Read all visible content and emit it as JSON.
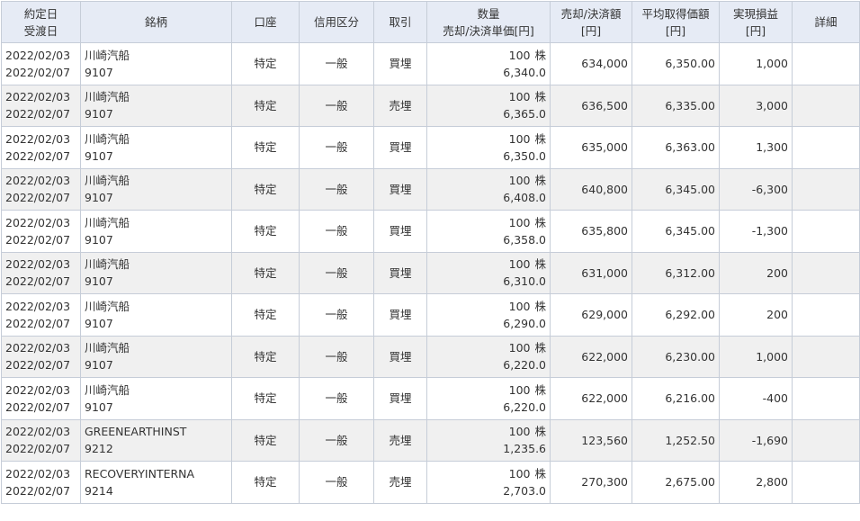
{
  "headers": {
    "date_top": "約定日",
    "date_bottom": "受渡日",
    "name": "銘柄",
    "account": "口座",
    "margin": "信用区分",
    "trade": "取引",
    "qty_top": "数量",
    "qty_bottom": "売却/決済単価[円]",
    "amount_top": "売却/決済額",
    "amount_bottom": "[円]",
    "avg_top": "平均取得価額",
    "avg_bottom": "[円]",
    "pl_top": "実現損益",
    "pl_bottom": "[円]",
    "detail": "詳細"
  },
  "rows": [
    {
      "trade_date": "2022/02/03",
      "settle_date": "2022/02/07",
      "name": "川崎汽船",
      "code": "9107",
      "account": "特定",
      "margin": "一般",
      "trade": "買埋",
      "qty": "100",
      "unit": "株",
      "price": "6,340.0",
      "amount": "634,000",
      "avg": "6,350.00",
      "pl": "1,000"
    },
    {
      "trade_date": "2022/02/03",
      "settle_date": "2022/02/07",
      "name": "川崎汽船",
      "code": "9107",
      "account": "特定",
      "margin": "一般",
      "trade": "売埋",
      "qty": "100",
      "unit": "株",
      "price": "6,365.0",
      "amount": "636,500",
      "avg": "6,335.00",
      "pl": "3,000"
    },
    {
      "trade_date": "2022/02/03",
      "settle_date": "2022/02/07",
      "name": "川崎汽船",
      "code": "9107",
      "account": "特定",
      "margin": "一般",
      "trade": "買埋",
      "qty": "100",
      "unit": "株",
      "price": "6,350.0",
      "amount": "635,000",
      "avg": "6,363.00",
      "pl": "1,300"
    },
    {
      "trade_date": "2022/02/03",
      "settle_date": "2022/02/07",
      "name": "川崎汽船",
      "code": "9107",
      "account": "特定",
      "margin": "一般",
      "trade": "買埋",
      "qty": "100",
      "unit": "株",
      "price": "6,408.0",
      "amount": "640,800",
      "avg": "6,345.00",
      "pl": "-6,300"
    },
    {
      "trade_date": "2022/02/03",
      "settle_date": "2022/02/07",
      "name": "川崎汽船",
      "code": "9107",
      "account": "特定",
      "margin": "一般",
      "trade": "買埋",
      "qty": "100",
      "unit": "株",
      "price": "6,358.0",
      "amount": "635,800",
      "avg": "6,345.00",
      "pl": "-1,300"
    },
    {
      "trade_date": "2022/02/03",
      "settle_date": "2022/02/07",
      "name": "川崎汽船",
      "code": "9107",
      "account": "特定",
      "margin": "一般",
      "trade": "買埋",
      "qty": "100",
      "unit": "株",
      "price": "6,310.0",
      "amount": "631,000",
      "avg": "6,312.00",
      "pl": "200"
    },
    {
      "trade_date": "2022/02/03",
      "settle_date": "2022/02/07",
      "name": "川崎汽船",
      "code": "9107",
      "account": "特定",
      "margin": "一般",
      "trade": "買埋",
      "qty": "100",
      "unit": "株",
      "price": "6,290.0",
      "amount": "629,000",
      "avg": "6,292.00",
      "pl": "200"
    },
    {
      "trade_date": "2022/02/03",
      "settle_date": "2022/02/07",
      "name": "川崎汽船",
      "code": "9107",
      "account": "特定",
      "margin": "一般",
      "trade": "買埋",
      "qty": "100",
      "unit": "株",
      "price": "6,220.0",
      "amount": "622,000",
      "avg": "6,230.00",
      "pl": "1,000"
    },
    {
      "trade_date": "2022/02/03",
      "settle_date": "2022/02/07",
      "name": "川崎汽船",
      "code": "9107",
      "account": "特定",
      "margin": "一般",
      "trade": "買埋",
      "qty": "100",
      "unit": "株",
      "price": "6,220.0",
      "amount": "622,000",
      "avg": "6,216.00",
      "pl": "-400"
    },
    {
      "trade_date": "2022/02/03",
      "settle_date": "2022/02/07",
      "name": "GREENEARTHINST",
      "code": "9212",
      "account": "特定",
      "margin": "一般",
      "trade": "売埋",
      "qty": "100",
      "unit": "株",
      "price": "1,235.6",
      "amount": "123,560",
      "avg": "1,252.50",
      "pl": "-1,690"
    },
    {
      "trade_date": "2022/02/03",
      "settle_date": "2022/02/07",
      "name": "RECOVERYINTERNA",
      "code": "9214",
      "account": "特定",
      "margin": "一般",
      "trade": "売埋",
      "qty": "100",
      "unit": "株",
      "price": "2,703.0",
      "amount": "270,300",
      "avg": "2,675.00",
      "pl": "2,800"
    }
  ],
  "colors": {
    "header_bg": "#e6ebf5",
    "stripe_bg": "#f0f0f0",
    "border": "#c6cdd8"
  }
}
